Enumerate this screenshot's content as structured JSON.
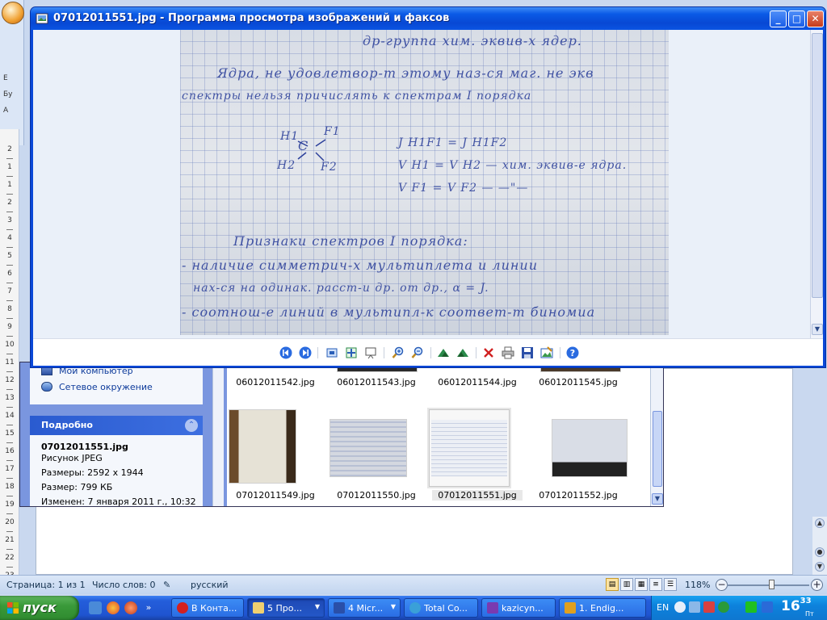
{
  "viewer": {
    "title": "07012011551.jpg - Программа просмотра изображений и факсов",
    "toolbar": {
      "prev": "previous-image",
      "next": "next-image",
      "best_fit": "best-fit",
      "actual_size": "actual-size",
      "slideshow": "slideshow",
      "zoom_in": "zoom-in",
      "zoom_out": "zoom-out",
      "rotate_cw": "rotate-clockwise",
      "rotate_ccw": "rotate-counterclockwise",
      "delete": "delete",
      "print": "print",
      "save": "save",
      "edit": "open-for-editing",
      "help": "help"
    },
    "photo_lines": [
      "др-группа хим. эквив-х ядер.",
      "Ядра, не удовлетвор-т этому наз-ся маг. не экв",
      "спектры нельзя причислять к спектрам I порядка",
      "J H1F1 = J H1F2",
      "V H1 = V H2 — хим. эквив-е ядра.",
      "V F1 = V F2 — —\"—",
      "Признаки спектров I порядка:",
      "- наличие симметрич-х мультиплета и линии",
      "нах-ся на одинак. расст-и др. от др., α = J.",
      "- соотнош-е линий в мультипл-к соответ-т биномиа"
    ],
    "molecule": {
      "h1": "H1",
      "h2": "H2",
      "c": "C",
      "f1": "F1",
      "f2": "F2"
    }
  },
  "explorer": {
    "links": [
      {
        "label": "Мой компьютер"
      },
      {
        "label": "Сетевое окружение"
      }
    ],
    "details": {
      "header": "Подробно",
      "filename": "07012011551.jpg",
      "type": "Рисунок JPEG",
      "dimensions": "Размеры: 2592 x 1944",
      "size": "Размер: 799 КБ",
      "modified": "Изменен: 7 января 2011 г., 10:32"
    },
    "thumbnails_row1": [
      "06012011542.jpg",
      "06012011543.jpg",
      "06012011544.jpg",
      "06012011545.jpg"
    ],
    "thumbnails_row2": [
      "07012011549.jpg",
      "07012011550.jpg",
      "07012011551.jpg",
      "07012011552.jpg"
    ],
    "selected": "07012011551.jpg"
  },
  "word": {
    "ruler_numbers": [
      "2",
      "1",
      "1",
      "2",
      "3",
      "4",
      "5",
      "6",
      "7",
      "8",
      "9",
      "10",
      "11",
      "12",
      "13",
      "14",
      "15",
      "16",
      "17",
      "18",
      "19",
      "20",
      "21",
      "22",
      "23"
    ],
    "ribbon_fragments": [
      "Е",
      "Бу",
      "А"
    ],
    "status": {
      "page": "Страница: 1 из 1",
      "words": "Число слов: 0",
      "language": "русский",
      "zoom": "118%"
    }
  },
  "taskbar": {
    "start": "пуск",
    "tasks": [
      {
        "label": "В Конта..."
      },
      {
        "label": "5 Про..."
      },
      {
        "label": "4 Micr..."
      },
      {
        "label": "Total Co..."
      },
      {
        "label": "kazicyn..."
      },
      {
        "label": "1. Endig..."
      }
    ],
    "lang": "EN",
    "clock_hours": "16",
    "clock_minutes": "33",
    "clock_day": "Пт"
  },
  "colors": {
    "xp_blue": "#0a54e2",
    "ink": "#2b3f9a",
    "start_green": "#3a9a3a"
  }
}
